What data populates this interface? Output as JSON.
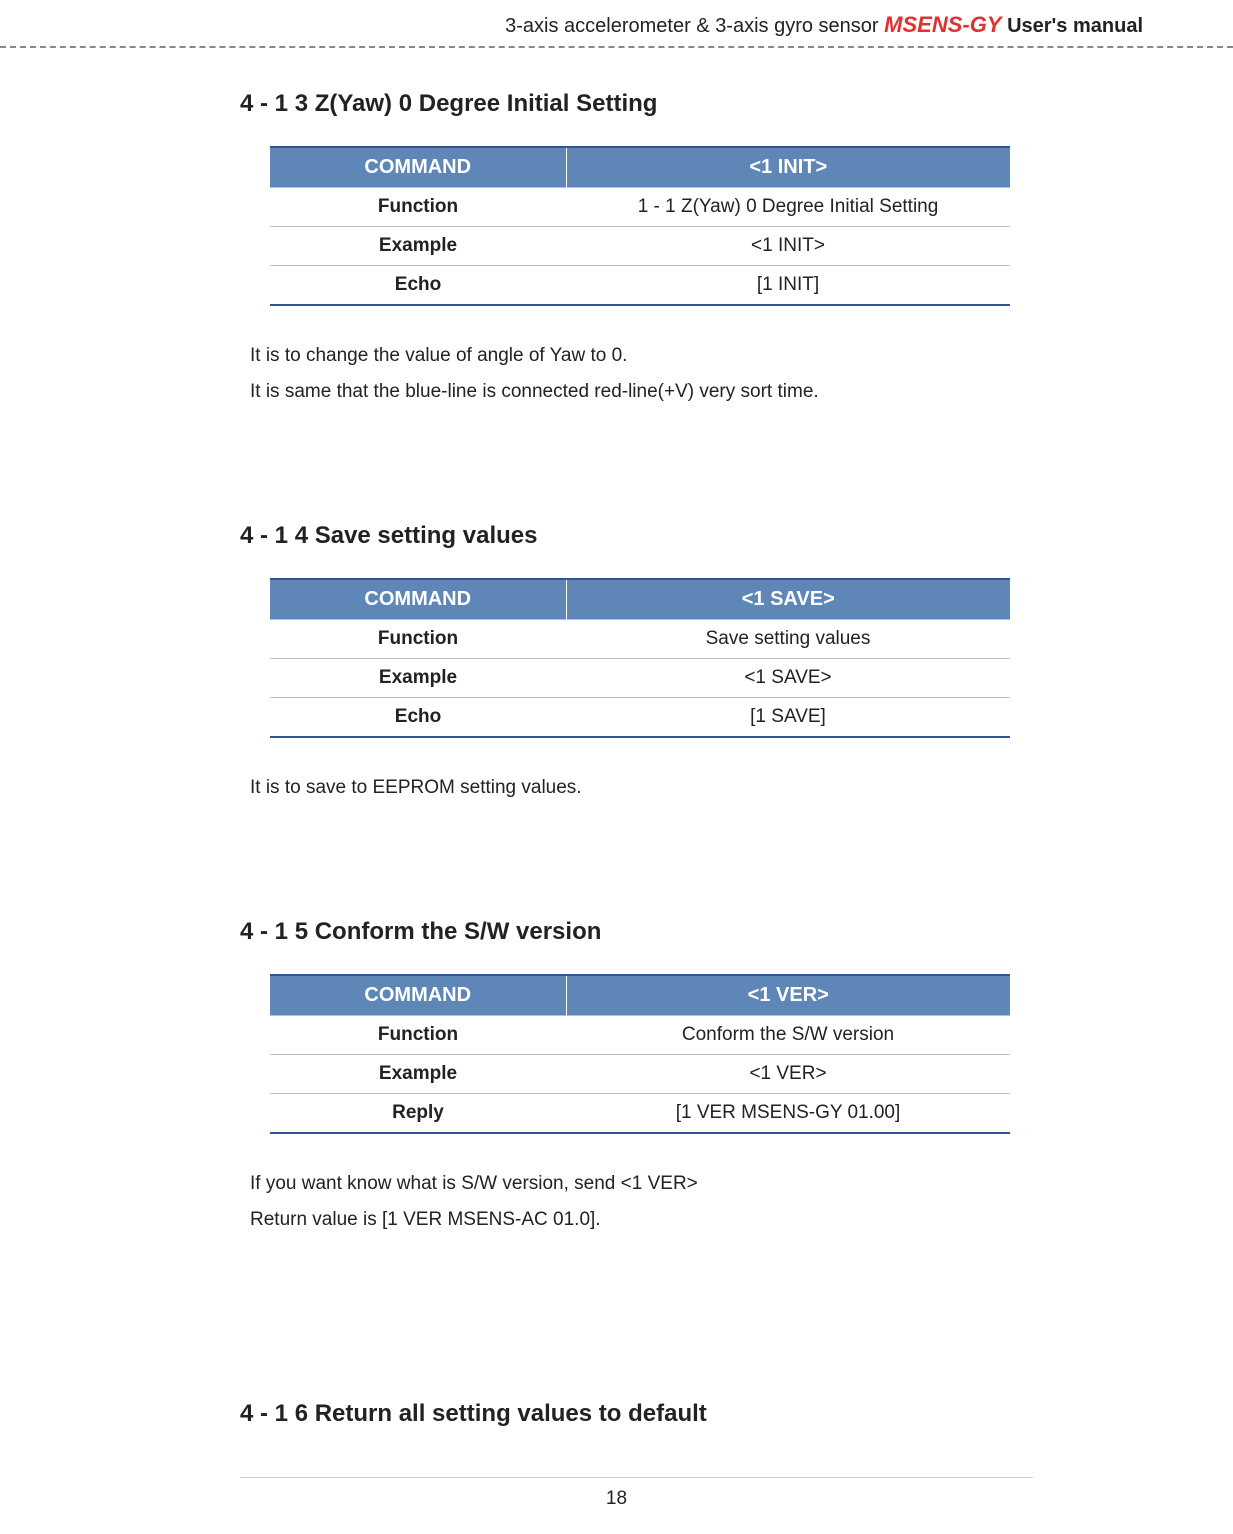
{
  "header": {
    "left": "3-axis accelerometer & 3-axis gyro sensor ",
    "product": "MSENS-GY",
    "right": "  User's manual"
  },
  "s1": {
    "title": "4 - 1  3 Z(Yaw) 0 Degree Initial Setting",
    "th1": "COMMAND",
    "th2": "<1 INIT>",
    "r1a": "Function",
    "r1b": "1 - 1 Z(Yaw) 0 Degree Initial Setting",
    "r2a": "Example",
    "r2b": "<1 INIT>",
    "r3a": "Echo",
    "r3b": "[1 INIT]",
    "p1": "It is to change the value of angle of Yaw to 0.",
    "p2": "It is same that the blue-line is connected red-line(+V) very sort time."
  },
  "s2": {
    "title": "4 - 1  4 Save setting values",
    "th1": "COMMAND",
    "th2": "<1 SAVE>",
    "r1a": "Function",
    "r1b": "Save setting values",
    "r2a": "Example",
    "r2b": "<1 SAVE>",
    "r3a": "Echo",
    "r3b": "[1 SAVE]",
    "p1": "It is to save to EEPROM setting values."
  },
  "s3": {
    "title": "4 - 1  5 Conform the S/W version",
    "th1": "COMMAND",
    "th2": "<1 VER>",
    "r1a": "Function",
    "r1b": "Conform the S/W version",
    "r2a": "Example",
    "r2b": "<1 VER>",
    "r3a": "Reply",
    "r3b": "[1 VER MSENS-GY 01.00]",
    "p1": "If you want know what is S/W version, send <1 VER>",
    "p2": "Return value is [1 VER MSENS-AC 01.0]."
  },
  "s4": {
    "title": "4 - 1  6 Return all setting values to default"
  },
  "pagenum": "18"
}
